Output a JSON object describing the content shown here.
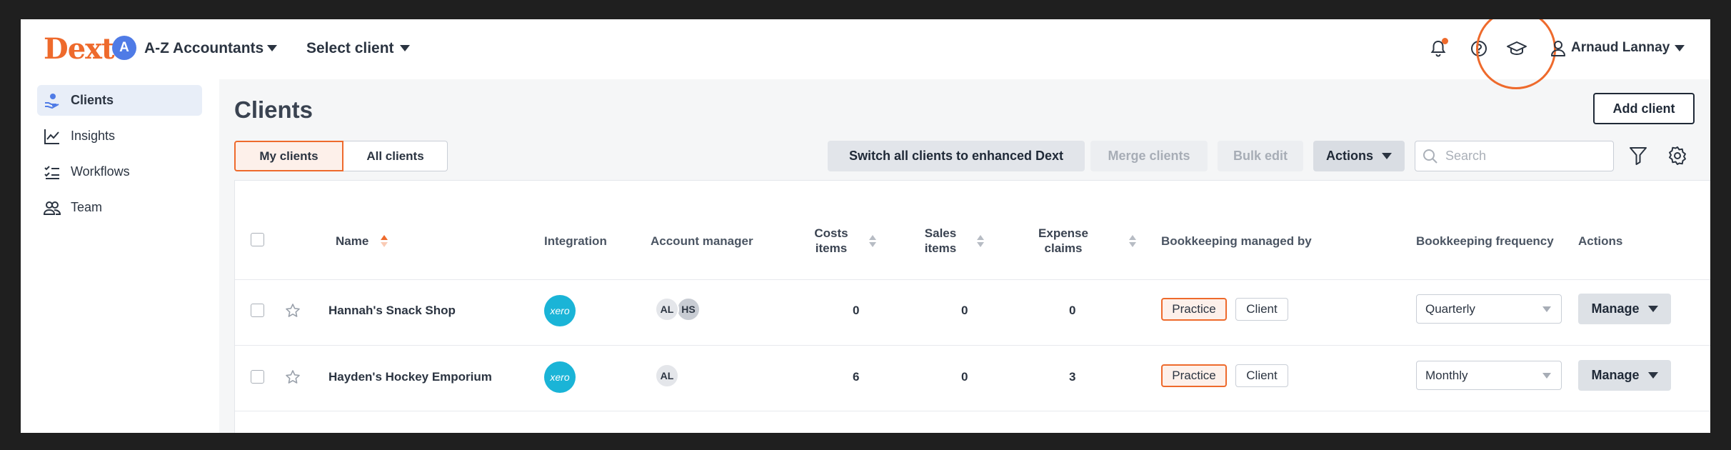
{
  "app": {
    "logo": "Dext",
    "org_avatar": "A",
    "org_name": "A-Z Accountants",
    "client_select": "Select client",
    "user_name": "Arnaud Lannay",
    "accent_color": "#ee6a2c",
    "icons": [
      "bell-icon",
      "help-icon",
      "graduation-cap-icon",
      "user-icon"
    ]
  },
  "sidebar": {
    "items": [
      {
        "label": "Clients",
        "icon": "clients-icon",
        "active": true
      },
      {
        "label": "Insights",
        "icon": "chart-line-icon",
        "active": false
      },
      {
        "label": "Workflows",
        "icon": "checklist-icon",
        "active": false
      },
      {
        "label": "Team",
        "icon": "team-icon",
        "active": false
      }
    ]
  },
  "main": {
    "title": "Clients",
    "add_client": "Add client",
    "tabs": [
      "My clients",
      "All clients"
    ],
    "toolbar": {
      "switch": "Switch all clients to enhanced Dext",
      "merge": "Merge clients",
      "bulk": "Bulk edit",
      "actions": "Actions",
      "search_placeholder": "Search"
    }
  },
  "table": {
    "headers": {
      "name": "Name",
      "integration": "Integration",
      "account_manager": "Account manager",
      "costs_line1": "Costs",
      "costs_line2": "items",
      "sales_line1": "Sales",
      "sales_line2": "items",
      "expense_line1": "Expense",
      "expense_line2": "claims",
      "managed_by": "Bookkeeping managed by",
      "frequency": "Bookkeeping frequency",
      "actions": "Actions"
    },
    "rows": [
      {
        "name": "Hannah's Snack Shop",
        "integration": "xero",
        "managers": [
          "AL",
          "HS"
        ],
        "costs": "0",
        "sales": "0",
        "expenses": "0",
        "managed_options": [
          "Practice",
          "Client"
        ],
        "managed_selected": "Practice",
        "frequency": "Quarterly",
        "action": "Manage"
      },
      {
        "name": "Hayden's Hockey Emporium",
        "integration": "xero",
        "managers": [
          "AL"
        ],
        "costs": "6",
        "sales": "0",
        "expenses": "3",
        "managed_options": [
          "Practice",
          "Client"
        ],
        "managed_selected": "Practice",
        "frequency": "Monthly",
        "action": "Manage"
      }
    ]
  }
}
